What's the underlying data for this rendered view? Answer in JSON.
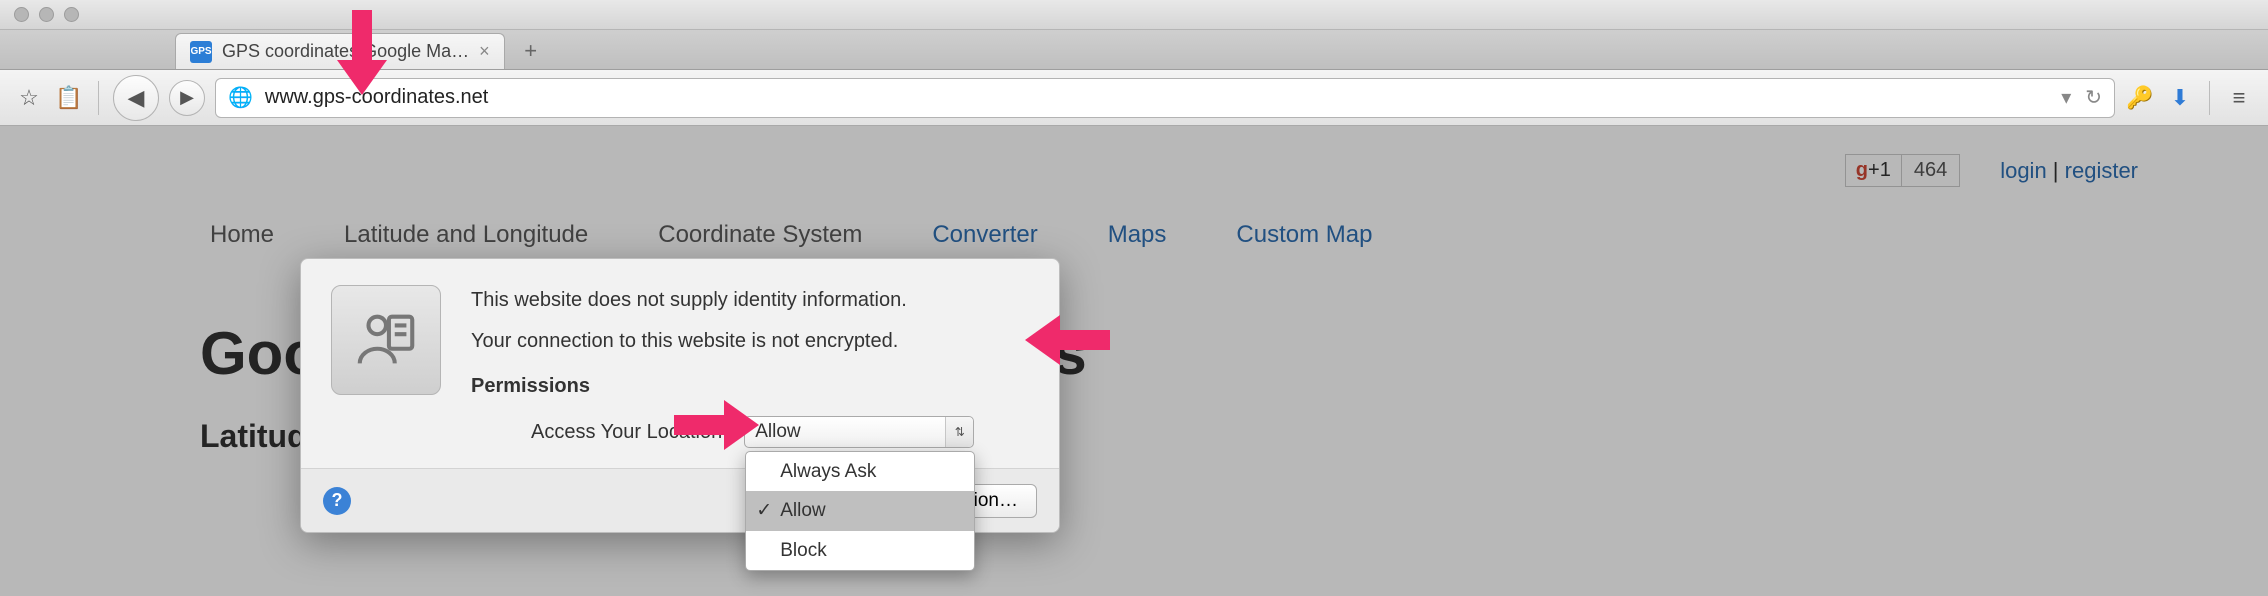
{
  "window": {
    "tab_title": "GPS coordinates Google Ma…",
    "favicon_text": "GPS",
    "url": "www.gps-coordinates.net"
  },
  "toolbar_icons": {
    "bookmark": "☆",
    "clipboard": "📋",
    "back": "◀",
    "forward": "▶",
    "globe": "🌐",
    "dropdown": "▾",
    "reload": "↻",
    "key": "🔑",
    "download": "⬇",
    "menu": "≡"
  },
  "page": {
    "gplus_label": "+1",
    "gplus_count": "464",
    "login": "login",
    "register": "register",
    "sep": " | ",
    "nav": [
      "Home",
      "Latitude and Longitude",
      "Coordinate System",
      "Converter",
      "Maps",
      "Custom Map"
    ],
    "h1": "Google Maps GPS Coordinates",
    "h2": "Latitude and longitude of an address"
  },
  "popover": {
    "line1": "This website does not supply identity information.",
    "line2": "Your connection to this website is not encrypted.",
    "perm_heading": "Permissions",
    "perm_label": "Access Your Location",
    "selected": "Allow",
    "options": [
      "Always Ask",
      "Allow",
      "Block"
    ],
    "more_info": "More Information…",
    "help": "?"
  },
  "colors": {
    "accent": "#2f6fb3",
    "pink": "#ef2a6b"
  }
}
